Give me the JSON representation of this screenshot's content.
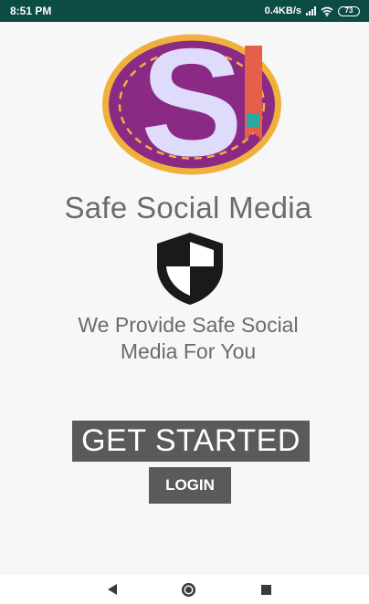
{
  "status_bar": {
    "time": "8:51 PM",
    "net_speed": "0.4KB/s",
    "battery": "73",
    "icons": [
      "signal-icon",
      "wifi-icon",
      "battery-icon"
    ]
  },
  "logo": {
    "letter": "S",
    "icon": "app-logo"
  },
  "app_title": "Safe Social Media",
  "shield_icon": "shield-icon",
  "tagline": {
    "line1": "We Provide Safe Social",
    "line2": "Media For You"
  },
  "buttons": {
    "get_started": "GET STARTED",
    "login": "LOGIN"
  },
  "nav_bar": {
    "icons": [
      "back-icon",
      "home-icon",
      "recents-icon"
    ]
  },
  "colors": {
    "status_bar": "#0d4b45",
    "button": "#5a5a5a",
    "text": "#6b6b6b",
    "logo_ring": "#f0b13c",
    "logo_disc": "#8b2a84",
    "logo_letter": "#dedbfb",
    "logo_ribbon": "#e4604a",
    "logo_ribbon_tip": "#2aa9a3"
  }
}
